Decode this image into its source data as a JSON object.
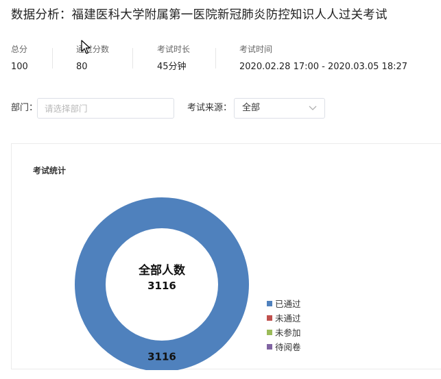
{
  "page": {
    "title": "数据分析：福建医科大学附属第一医院新冠肺炎防控知识人人过关考试"
  },
  "stats": [
    {
      "label": "总分",
      "value": "100"
    },
    {
      "label": "通过分数",
      "value": "80"
    },
    {
      "label": "考试时长",
      "value": "45分钟"
    },
    {
      "label": "考试时间",
      "value": "2020.02.28 17:00 - 2020.03.05 18:27"
    }
  ],
  "filters": {
    "dept_label": "部门：",
    "dept_placeholder": "请选择部门",
    "source_label": "考试来源：",
    "source_value": "全部"
  },
  "stats_panel": {
    "title": "考试统计",
    "center_title": "全部人数",
    "center_value": "3116"
  },
  "chart_data": {
    "type": "pie",
    "categories": [
      "已通过",
      "未通过",
      "未参加",
      "待阅卷"
    ],
    "values": [
      3116,
      0,
      0,
      0
    ],
    "colors": [
      "#4f81bd",
      "#c0504d",
      "#9bbb59",
      "#8064a2"
    ],
    "data_labels": [
      "3116",
      "",
      "",
      ""
    ],
    "legend_position": "right"
  },
  "icons": {
    "chevron": "chevron-down-icon",
    "cursor": "mouse-pointer-icon"
  }
}
